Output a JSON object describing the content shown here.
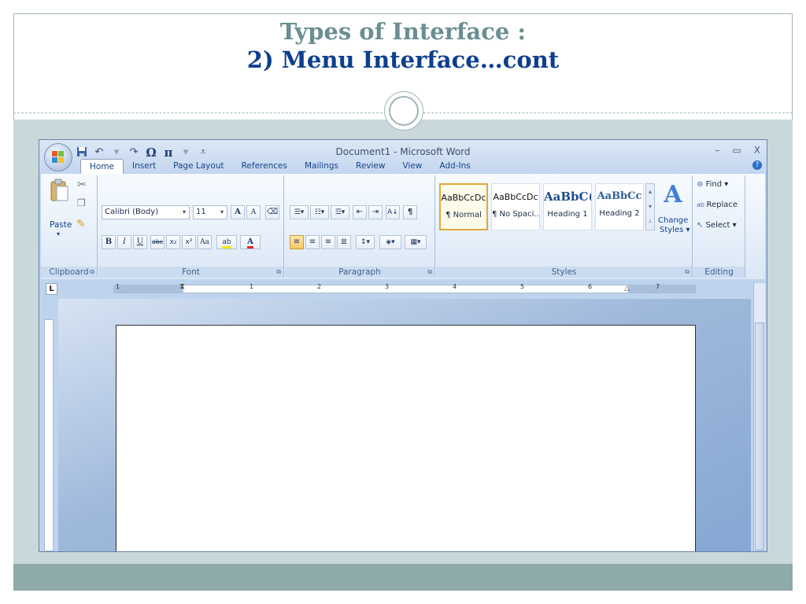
{
  "slide": {
    "title_line1": "Types of Interface :",
    "title_line2": "2) Menu Interface…cont"
  },
  "colors": {
    "title_gray": "#6b8e91",
    "title_blue": "#0d3f8e",
    "footer": "#8eaaa9"
  },
  "word": {
    "window_title": "Document1 - Microsoft Word",
    "tabs": [
      "Home",
      "Insert",
      "Page Layout",
      "References",
      "Mailings",
      "Review",
      "View",
      "Add-Ins"
    ],
    "window_controls": {
      "minimize": "–",
      "restore": "▭",
      "close": "X"
    },
    "help": "?",
    "clipboard": {
      "paste": "Paste",
      "label": "Clipboard"
    },
    "font": {
      "name": "Calibri (Body)",
      "size": "11",
      "label": "Font"
    },
    "paragraph": {
      "label": "Paragraph"
    },
    "styles": {
      "label": "Styles",
      "items": [
        {
          "sample": "AaBbCcDc",
          "name": "¶ Normal"
        },
        {
          "sample": "AaBbCcDc",
          "name": "¶ No Spaci..."
        },
        {
          "sample": "AaBbC(",
          "name": "Heading 1"
        },
        {
          "sample": "AaBbCc",
          "name": "Heading 2"
        }
      ],
      "change_styles_line1": "Change",
      "change_styles_line2": "Styles ▾"
    },
    "editing": {
      "find": "Find ▾",
      "replace": "Replace",
      "select": "Select ▾",
      "label": "Editing"
    },
    "ruler_numbers": [
      "1",
      "1",
      "2",
      "3",
      "4",
      "5",
      "6",
      "7"
    ],
    "tab_selector": "L"
  }
}
